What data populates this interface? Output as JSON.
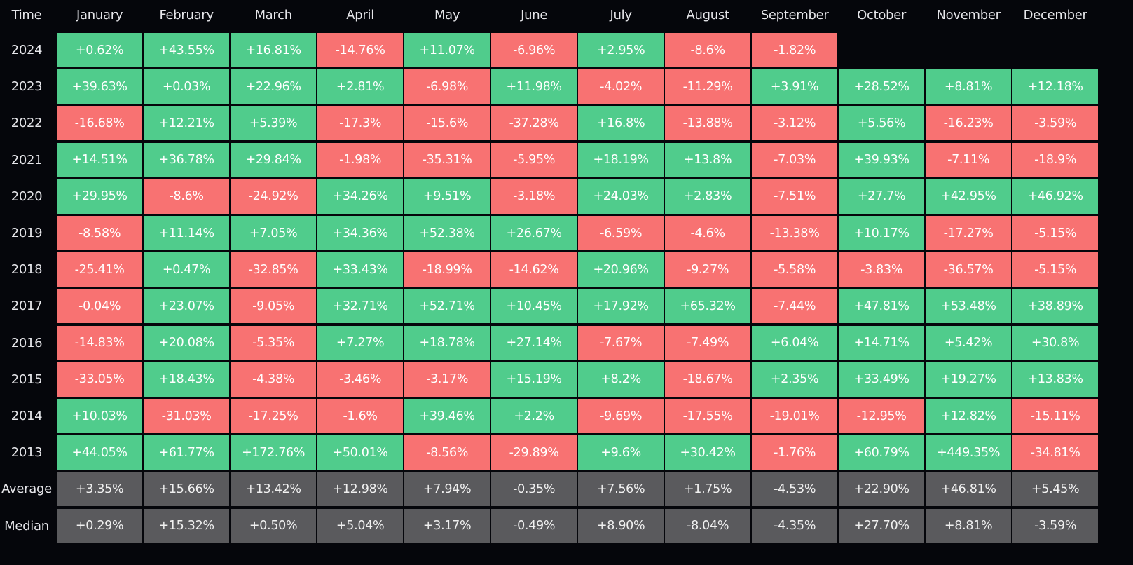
{
  "chart_data": {
    "type": "heatmap",
    "title": "",
    "corner_label": "Time",
    "months": [
      "January",
      "February",
      "March",
      "April",
      "May",
      "June",
      "July",
      "August",
      "September",
      "October",
      "November",
      "December"
    ],
    "rows": [
      {
        "label": "2024",
        "values": [
          "+0.62%",
          "+43.55%",
          "+16.81%",
          "-14.76%",
          "+11.07%",
          "-6.96%",
          "+2.95%",
          "-8.6%",
          "-1.82%",
          null,
          null,
          null
        ]
      },
      {
        "label": "2023",
        "values": [
          "+39.63%",
          "+0.03%",
          "+22.96%",
          "+2.81%",
          "-6.98%",
          "+11.98%",
          "-4.02%",
          "-11.29%",
          "+3.91%",
          "+28.52%",
          "+8.81%",
          "+12.18%"
        ]
      },
      {
        "label": "2022",
        "values": [
          "-16.68%",
          "+12.21%",
          "+5.39%",
          "-17.3%",
          "-15.6%",
          "-37.28%",
          "+16.8%",
          "-13.88%",
          "-3.12%",
          "+5.56%",
          "-16.23%",
          "-3.59%"
        ]
      },
      {
        "label": "2021",
        "values": [
          "+14.51%",
          "+36.78%",
          "+29.84%",
          "-1.98%",
          "-35.31%",
          "-5.95%",
          "+18.19%",
          "+13.8%",
          "-7.03%",
          "+39.93%",
          "-7.11%",
          "-18.9%"
        ]
      },
      {
        "label": "2020",
        "values": [
          "+29.95%",
          "-8.6%",
          "-24.92%",
          "+34.26%",
          "+9.51%",
          "-3.18%",
          "+24.03%",
          "+2.83%",
          "-7.51%",
          "+27.7%",
          "+42.95%",
          "+46.92%"
        ]
      },
      {
        "label": "2019",
        "values": [
          "-8.58%",
          "+11.14%",
          "+7.05%",
          "+34.36%",
          "+52.38%",
          "+26.67%",
          "-6.59%",
          "-4.6%",
          "-13.38%",
          "+10.17%",
          "-17.27%",
          "-5.15%"
        ]
      },
      {
        "label": "2018",
        "values": [
          "-25.41%",
          "+0.47%",
          "-32.85%",
          "+33.43%",
          "-18.99%",
          "-14.62%",
          "+20.96%",
          "-9.27%",
          "-5.58%",
          "-3.83%",
          "-36.57%",
          "-5.15%"
        ]
      },
      {
        "label": "2017",
        "values": [
          "-0.04%",
          "+23.07%",
          "-9.05%",
          "+32.71%",
          "+52.71%",
          "+10.45%",
          "+17.92%",
          "+65.32%",
          "-7.44%",
          "+47.81%",
          "+53.48%",
          "+38.89%"
        ]
      },
      {
        "label": "2016",
        "values": [
          "-14.83%",
          "+20.08%",
          "-5.35%",
          "+7.27%",
          "+18.78%",
          "+27.14%",
          "-7.67%",
          "-7.49%",
          "+6.04%",
          "+14.71%",
          "+5.42%",
          "+30.8%"
        ]
      },
      {
        "label": "2015",
        "values": [
          "-33.05%",
          "+18.43%",
          "-4.38%",
          "-3.46%",
          "-3.17%",
          "+15.19%",
          "+8.2%",
          "-18.67%",
          "+2.35%",
          "+33.49%",
          "+19.27%",
          "+13.83%"
        ]
      },
      {
        "label": "2014",
        "values": [
          "+10.03%",
          "-31.03%",
          "-17.25%",
          "-1.6%",
          "+39.46%",
          "+2.2%",
          "-9.69%",
          "-17.55%",
          "-19.01%",
          "-12.95%",
          "+12.82%",
          "-15.11%"
        ]
      },
      {
        "label": "2013",
        "values": [
          "+44.05%",
          "+61.77%",
          "+172.76%",
          "+50.01%",
          "-8.56%",
          "-29.89%",
          "+9.6%",
          "+30.42%",
          "-1.76%",
          "+60.79%",
          "+449.35%",
          "-34.81%"
        ]
      }
    ],
    "summary_rows": [
      {
        "label": "Average",
        "values": [
          "+3.35%",
          "+15.66%",
          "+13.42%",
          "+12.98%",
          "+7.94%",
          "-0.35%",
          "+7.56%",
          "+1.75%",
          "-4.53%",
          "+22.90%",
          "+46.81%",
          "+5.45%"
        ]
      },
      {
        "label": "Median",
        "values": [
          "+0.29%",
          "+15.32%",
          "+0.50%",
          "+5.04%",
          "+3.17%",
          "-0.49%",
          "+8.90%",
          "-8.04%",
          "-4.35%",
          "+27.70%",
          "+8.81%",
          "-3.59%"
        ]
      }
    ],
    "colors": {
      "positive": "#50cc8c",
      "negative": "#f87272",
      "summary": "#5a5a5d",
      "background": "#05060b"
    }
  }
}
